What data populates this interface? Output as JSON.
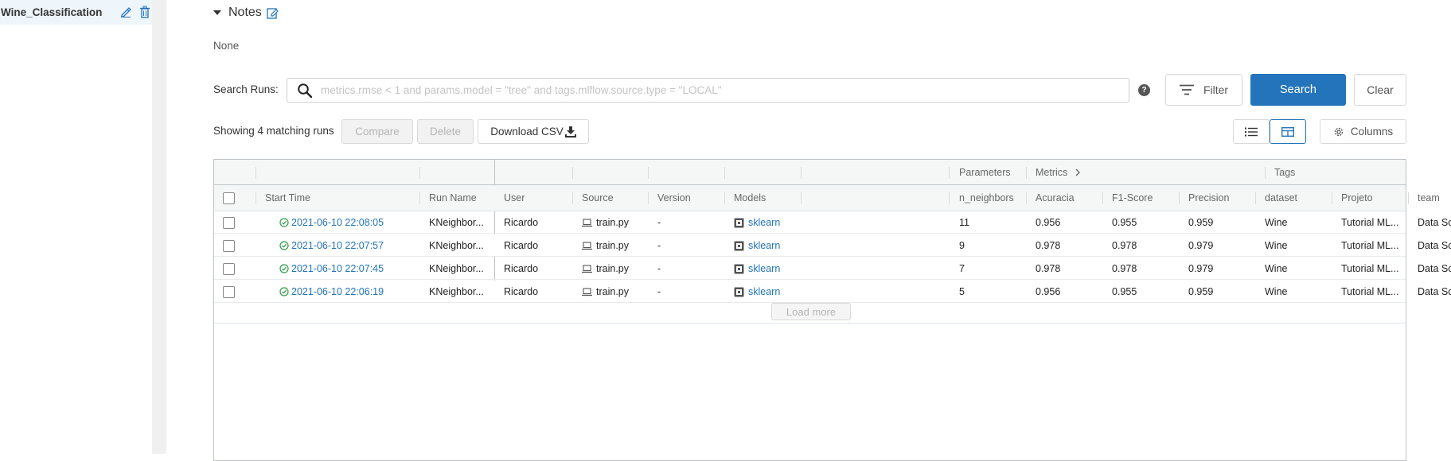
{
  "sidebar": {
    "experiment_name": "Wine_Classification"
  },
  "notes": {
    "title": "Notes",
    "body": "None"
  },
  "search": {
    "label": "Search Runs:",
    "placeholder": "metrics.rmse < 1 and params.model = \"tree\" and tags.mlflow.source.type = \"LOCAL\"",
    "help": "?",
    "filter_label": "Filter",
    "search_label": "Search",
    "clear_label": "Clear"
  },
  "toolbar": {
    "showing": "Showing 4 matching runs",
    "compare_label": "Compare",
    "delete_label": "Delete",
    "download_label": "Download CSV",
    "columns_label": "Columns"
  },
  "table": {
    "groups": {
      "parameters": "Parameters",
      "metrics": "Metrics",
      "tags": "Tags"
    },
    "columns": {
      "start_time": "Start Time",
      "run_name": "Run Name",
      "user": "User",
      "source": "Source",
      "version": "Version",
      "models": "Models",
      "n_neighbors": "n_neighbors",
      "acuracia": "Acuracia",
      "f1": "F1-Score",
      "precision": "Precision",
      "dataset": "dataset",
      "projeto": "Projeto",
      "team": "team"
    },
    "rows": [
      {
        "start_time": "2021-06-10 22:08:05",
        "run_name": "KNeighbor...",
        "user": "Ricardo",
        "source": "train.py",
        "version": "-",
        "model": "sklearn",
        "n_neighbors": "11",
        "acuracia": "0.956",
        "f1": "0.955",
        "precision": "0.959",
        "dataset": "Wine",
        "projeto": "Tutorial ML...",
        "team": "Data Science"
      },
      {
        "start_time": "2021-06-10 22:07:57",
        "run_name": "KNeighbor...",
        "user": "Ricardo",
        "source": "train.py",
        "version": "-",
        "model": "sklearn",
        "n_neighbors": "9",
        "acuracia": "0.978",
        "f1": "0.978",
        "precision": "0.979",
        "dataset": "Wine",
        "projeto": "Tutorial ML...",
        "team": "Data Science"
      },
      {
        "start_time": "2021-06-10 22:07:45",
        "run_name": "KNeighbor...",
        "user": "Ricardo",
        "source": "train.py",
        "version": "-",
        "model": "sklearn",
        "n_neighbors": "7",
        "acuracia": "0.978",
        "f1": "0.978",
        "precision": "0.979",
        "dataset": "Wine",
        "projeto": "Tutorial ML...",
        "team": "Data Science"
      },
      {
        "start_time": "2021-06-10 22:06:19",
        "run_name": "KNeighbor...",
        "user": "Ricardo",
        "source": "train.py",
        "version": "-",
        "model": "sklearn",
        "n_neighbors": "5",
        "acuracia": "0.956",
        "f1": "0.955",
        "precision": "0.959",
        "dataset": "Wine",
        "projeto": "Tutorial ML...",
        "team": "Data Science"
      }
    ],
    "load_more": "Load more"
  },
  "colors": {
    "accent": "#2374bb",
    "success": "#2e9d48"
  },
  "icons": [
    "edit-icon",
    "trash-icon",
    "search-icon",
    "help-icon",
    "filter-icon",
    "download-icon",
    "list-view-icon",
    "grid-view-icon",
    "gear-icon",
    "check-circle-icon",
    "laptop-icon",
    "model-icon",
    "chevron-right-icon"
  ]
}
